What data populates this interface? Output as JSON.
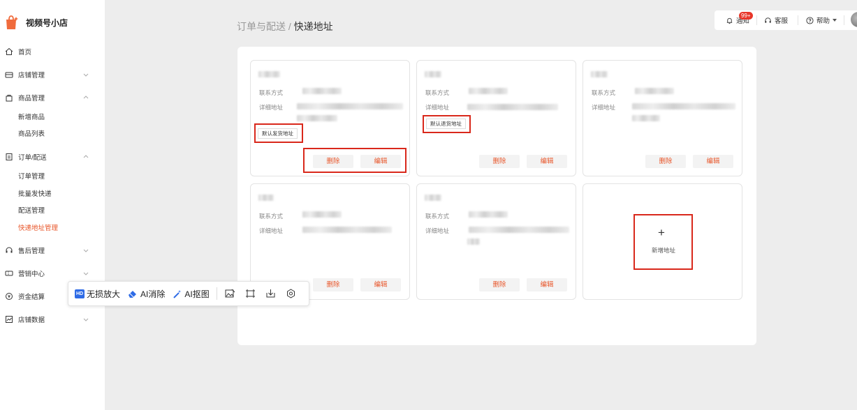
{
  "brand": {
    "name": "视频号小店"
  },
  "nav": {
    "home": "首页",
    "shop_mgmt": "店铺管理",
    "product_mgmt": "商品管理",
    "product_new": "新增商品",
    "product_list": "商品列表",
    "order_delivery": "订单/配送",
    "order_mgmt": "订单管理",
    "batch_ship": "批量发快递",
    "delivery_mgmt": "配送管理",
    "express_address": "快递地址管理",
    "after_sales": "售后管理",
    "marketing": "营销中心",
    "funds": "资金结算",
    "shop_data": "店铺数据"
  },
  "breadcrumb": {
    "parent": "订单与配送",
    "sep": " / ",
    "current": "快递地址"
  },
  "topbar": {
    "notify": "通知",
    "notify_badge": "99+",
    "service": "客服",
    "help": "帮助"
  },
  "cards": {
    "contact_label": "联系方式",
    "address_label": "详细地址",
    "delete": "删除",
    "edit": "编辑",
    "default_ship": "默认发货地址",
    "default_return": "默认退货地址"
  },
  "add_address": {
    "plus": "+",
    "label": "新增地址"
  },
  "float_toolbar": {
    "upscale": "无损放大",
    "ai_erase": "AI消除",
    "ai_cutout": "AI抠图",
    "hd": "HD"
  },
  "colors": {
    "accent": "#e8562a",
    "highlight_box": "#d9281b",
    "badge": "#e8362a"
  }
}
